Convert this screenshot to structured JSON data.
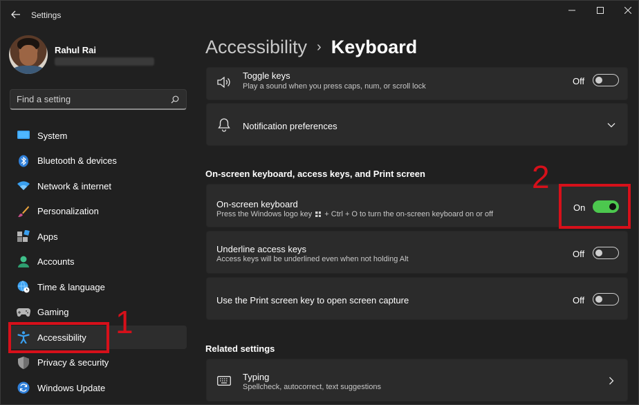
{
  "window": {
    "app_title": "Settings"
  },
  "profile": {
    "name": "Rahul Rai"
  },
  "search": {
    "placeholder": "Find a setting"
  },
  "sidebar": {
    "items": [
      {
        "label": "System",
        "icon": "monitor-icon"
      },
      {
        "label": "Bluetooth & devices",
        "icon": "bluetooth-icon"
      },
      {
        "label": "Network & internet",
        "icon": "wifi-icon"
      },
      {
        "label": "Personalization",
        "icon": "brush-icon"
      },
      {
        "label": "Apps",
        "icon": "apps-icon"
      },
      {
        "label": "Accounts",
        "icon": "person-icon"
      },
      {
        "label": "Time & language",
        "icon": "globe-clock-icon"
      },
      {
        "label": "Gaming",
        "icon": "gamepad-icon"
      },
      {
        "label": "Accessibility",
        "icon": "accessibility-icon",
        "active": true
      },
      {
        "label": "Privacy & security",
        "icon": "shield-icon"
      },
      {
        "label": "Windows Update",
        "icon": "update-icon"
      }
    ]
  },
  "breadcrumb": {
    "parent": "Accessibility",
    "separator": "›",
    "current": "Keyboard"
  },
  "settings": {
    "toggle_keys": {
      "title": "Toggle keys",
      "desc": "Play a sound when you press caps, num, or scroll lock",
      "state": "Off"
    },
    "notification_preferences": {
      "title": "Notification preferences"
    },
    "section_onscreen": "On-screen keyboard, access keys, and Print screen",
    "onscreen_keyboard": {
      "title": "On-screen keyboard",
      "desc_before": "Press the Windows logo key",
      "desc_after": "+ Ctrl + O to turn the on-screen keyboard on or off",
      "state": "On"
    },
    "underline_access_keys": {
      "title": "Underline access keys",
      "desc": "Access keys will be underlined even when not holding Alt",
      "state": "Off"
    },
    "print_screen": {
      "title": "Use the Print screen key to open screen capture",
      "state": "Off"
    },
    "section_related": "Related settings",
    "typing": {
      "title": "Typing",
      "desc": "Spellcheck, autocorrect, text suggestions"
    }
  },
  "annotations": {
    "label_1": "1",
    "label_2": "2",
    "color": "#d6101a"
  },
  "colors": {
    "background": "#202020",
    "card": "#2b2b2b",
    "toggle_on": "#4cc84e",
    "accent_blue": "#2f7fd8"
  }
}
